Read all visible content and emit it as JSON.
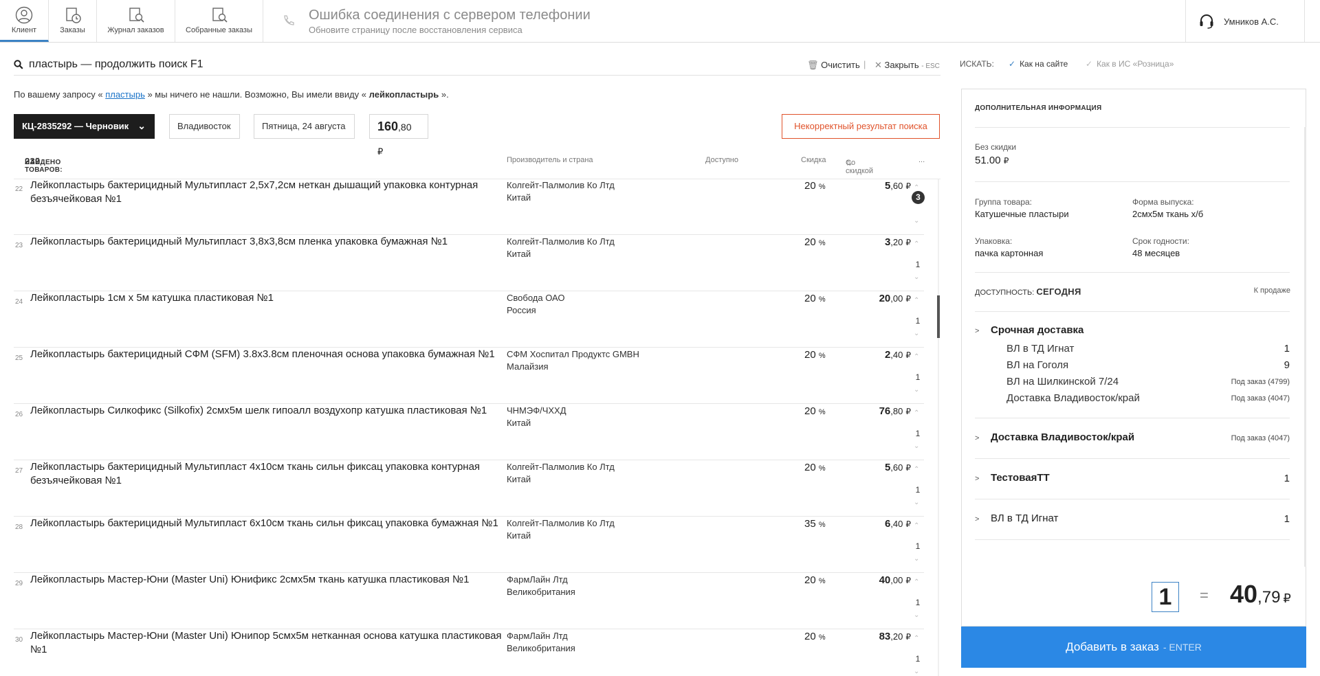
{
  "nav": {
    "items": [
      {
        "label": "Клиент",
        "icon": "user-icon"
      },
      {
        "label": "Заказы",
        "icon": "orders-clock-icon"
      },
      {
        "label": "Журнал заказов",
        "icon": "orders-journal-search-icon"
      },
      {
        "label": "Собранные заказы",
        "icon": "assembled-orders-search-icon"
      }
    ]
  },
  "status": {
    "title": "Ошибка соединения с сервером телефонии",
    "subtitle": "Обновите страницу после восстановления сервиса"
  },
  "user": {
    "name": "Умников А.С."
  },
  "search": {
    "query": "пластырь — продолжить поиск F1",
    "clear_label": "Очистить",
    "close_label": "Закрыть",
    "close_key": "- ESC",
    "mode_label": "ИСКАТЬ:",
    "mode_site": "Как на сайте",
    "mode_retail": "Как в ИС «Розница»"
  },
  "notfound": {
    "prefix": "По вашему запросу «",
    "term": "пластырь",
    "middle": "» мы ничего не нашли. Возможно, Вы имели ввиду «",
    "suggest": "лейкопластырь",
    "suffix": "»."
  },
  "order": {
    "id_label": "КЦ-2835292 — Черновик",
    "city": "Владивосток",
    "date": "Пятница, 24 августа",
    "sum_int": "160",
    "sum_frac": ",80",
    "currency": "₽",
    "bad_result_label": "Некорректный результат поиска"
  },
  "table": {
    "found_label": "НАЙДЕНО ТОВАРОВ:",
    "found_count": "239",
    "col_mfr": "Производитель и страна",
    "col_avail": "Доступно",
    "col_disc": "Скидка",
    "col_price": "Со скидкой",
    "col_more": "...",
    "rows": [
      {
        "num": "22",
        "title": "Лейкопластырь бактерицидный Мультипласт 2,5х7,2см неткан дышащий упаковка контурная безъячейковая №1",
        "mfr": "Колгейт-Палмолив Ко Лтд",
        "country": "Китай",
        "disc": "20",
        "price_int": "5",
        "price_frac": ",60",
        "qty": "3"
      },
      {
        "num": "23",
        "title": "Лейкопластырь бактерицидный Мультипласт 3,8х3,8см пленка упаковка бумажная №1",
        "mfr": "Колгейт-Палмолив Ко Лтд",
        "country": "Китай",
        "disc": "20",
        "price_int": "3",
        "price_frac": ",20",
        "qty": "1"
      },
      {
        "num": "24",
        "title": "Лейкопластырь 1см х 5м катушка пластиковая №1",
        "mfr": "Свобода ОАО",
        "country": "Россия",
        "disc": "20",
        "price_int": "20",
        "price_frac": ",00",
        "qty": "1"
      },
      {
        "num": "25",
        "title": "Лейкопластырь бактерицидный СФМ (SFM) 3.8х3.8см пленочная основа упаковка бумажная №1",
        "mfr": "СФМ Хоспитал Продуктс GMBH",
        "country": "Малайзия",
        "disc": "20",
        "price_int": "2",
        "price_frac": ",40",
        "qty": "1"
      },
      {
        "num": "26",
        "title": "Лейкопластырь Силкофикс (Silkofix) 2смх5м шелк гипоалл воздухопр катушка пластиковая №1",
        "mfr": "ЧНМЭФ/ЧХХД",
        "country": "Китай",
        "disc": "20",
        "price_int": "76",
        "price_frac": ",80",
        "qty": "1"
      },
      {
        "num": "27",
        "title": "Лейкопластырь бактерицидный Мультипласт 4х10см ткань сильн фиксац упаковка контурная безъячейковая №1",
        "mfr": "Колгейт-Палмолив Ко Лтд",
        "country": "Китай",
        "disc": "20",
        "price_int": "5",
        "price_frac": ",60",
        "qty": "1"
      },
      {
        "num": "28",
        "title": "Лейкопластырь бактерицидный Мультипласт 6х10см ткань сильн фиксац упаковка бумажная №1",
        "mfr": "Колгейт-Палмолив Ко Лтд",
        "country": "Китай",
        "disc": "35",
        "price_int": "6",
        "price_frac": ",40",
        "qty": "1"
      },
      {
        "num": "29",
        "title": "Лейкопластырь Мастер-Юни (Master Uni) Юнификс 2смх5м ткань катушка пластиковая №1",
        "mfr": "ФармЛайн Лтд",
        "country": "Великобритания",
        "disc": "20",
        "price_int": "40",
        "price_frac": ",00",
        "qty": "1"
      },
      {
        "num": "30",
        "title": "Лейкопластырь Мастер-Юни (Master Uni) Юнипор 5смх5м нетканная основа катушка пластиковая №1",
        "mfr": "ФармЛайн Лтд",
        "country": "Великобритания",
        "disc": "20",
        "price_int": "83",
        "price_frac": ",20",
        "qty": "1"
      }
    ]
  },
  "detail": {
    "header": "ДОПОЛНИТЕЛЬНАЯ ИНФОРМАЦИЯ",
    "no_disc_label": "Без скидки",
    "no_disc_value": "51.00",
    "group_label": "Группа товара:",
    "group_value": "Катушечные пластыри",
    "form_label": "Форма выпуска:",
    "form_value": "2смх5м ткань х/б",
    "pack_label": "Упаковка:",
    "pack_value": "пачка картонная",
    "shelf_label": "Срок годности:",
    "shelf_value": "48 месяцев",
    "avail_label": "ДОСТУПНОСТЬ:",
    "avail_value": "СЕГОДНЯ",
    "sale_label": "К продаже",
    "express": {
      "name": "Срочная доставка",
      "items": [
        {
          "name": "ВЛ в ТД Игнат",
          "value": "1"
        },
        {
          "name": "ВЛ на Гоголя",
          "value": "9"
        },
        {
          "name": "ВЛ на Шилкинской 7/24",
          "value": "Под заказ (4799)"
        },
        {
          "name": "Доставка Владивосток/край",
          "value": "Под заказ (4047)"
        }
      ]
    },
    "sections": [
      {
        "name": "Доставка Владивосток/край",
        "value": "Под заказ (4047)"
      },
      {
        "name": "ТестоваяТТ",
        "value": "1"
      },
      {
        "name": "ВЛ в ТД Игнат",
        "value": "1"
      }
    ]
  },
  "cart": {
    "qty": "1",
    "eq": "=",
    "total_int": "40",
    "total_frac": ",79",
    "add_label": "Добавить в заказ",
    "add_key": "- ENTER"
  }
}
